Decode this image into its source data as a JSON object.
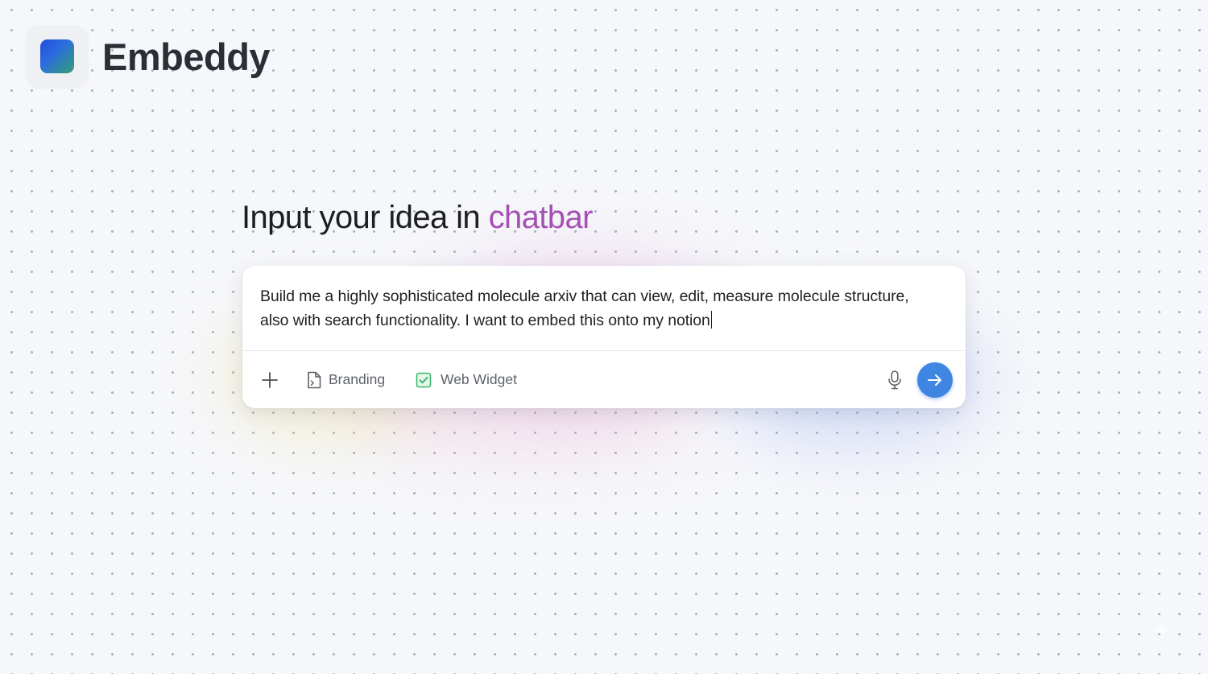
{
  "app": {
    "name": "Embeddy"
  },
  "headline": {
    "text": "Input your idea in ",
    "accent": "chatbar"
  },
  "chat": {
    "prompt_line1": "Build me a highly sophisticated molecule arxiv that can view, edit, measure molecule structure,",
    "prompt_line2": "also with search functionality. I want to embed this onto my notion",
    "toolbar": {
      "add_icon": "plus-icon",
      "branding_label": "Branding",
      "branding_icon": "document-icon",
      "widget_label": "Web Widget",
      "widget_icon": "checkbox-checked-icon",
      "widget_checked": true,
      "mic_icon": "microphone-icon",
      "send_icon": "arrow-right-icon"
    }
  },
  "colors": {
    "accent_text": "#a44fb4",
    "send_button": "#3f86e3",
    "checkbox_green": "#3db86a"
  }
}
